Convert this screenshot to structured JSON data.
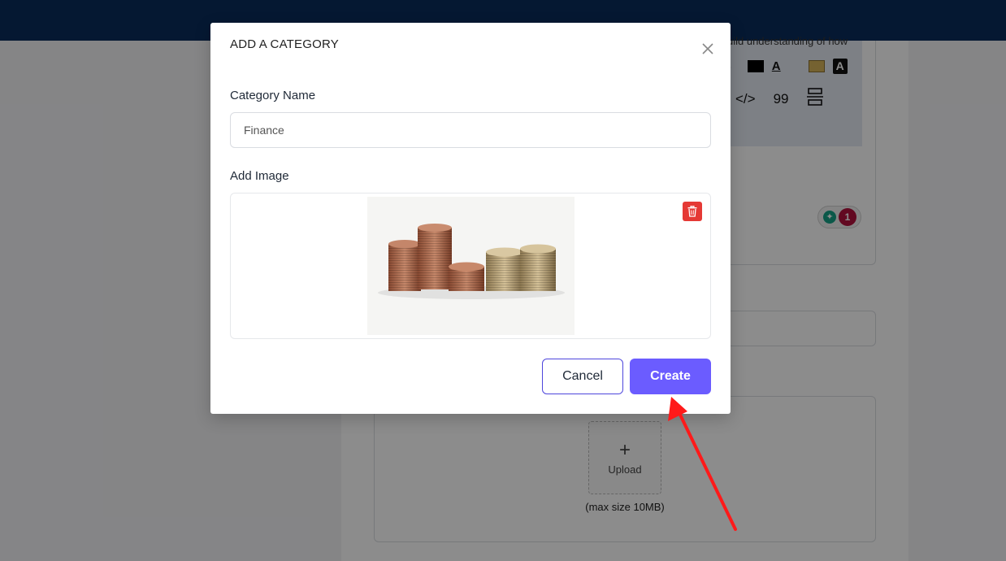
{
  "background": {
    "editor_hint": "uild understanding of how",
    "toolbar_row1_fragment": "e",
    "font_color_glyph": "A",
    "highlight_glyph": "A",
    "toolbar_row2": [
      "</>",
      "99",
      "☰"
    ],
    "grammar_count": "1",
    "upload_label": "Upload",
    "upload_plus": "+",
    "max_size_text": "(max size 10MB)"
  },
  "modal": {
    "title": "ADD A CATEGORY",
    "category_name_label": "Category Name",
    "category_name_value": "Finance",
    "add_image_label": "Add Image",
    "cancel_label": "Cancel",
    "create_label": "Create"
  },
  "colors": {
    "topbar": "#0a2d5c",
    "primary": "#6b5cff",
    "danger": "#e53935",
    "annotation_arrow": "#ff1a1a"
  }
}
